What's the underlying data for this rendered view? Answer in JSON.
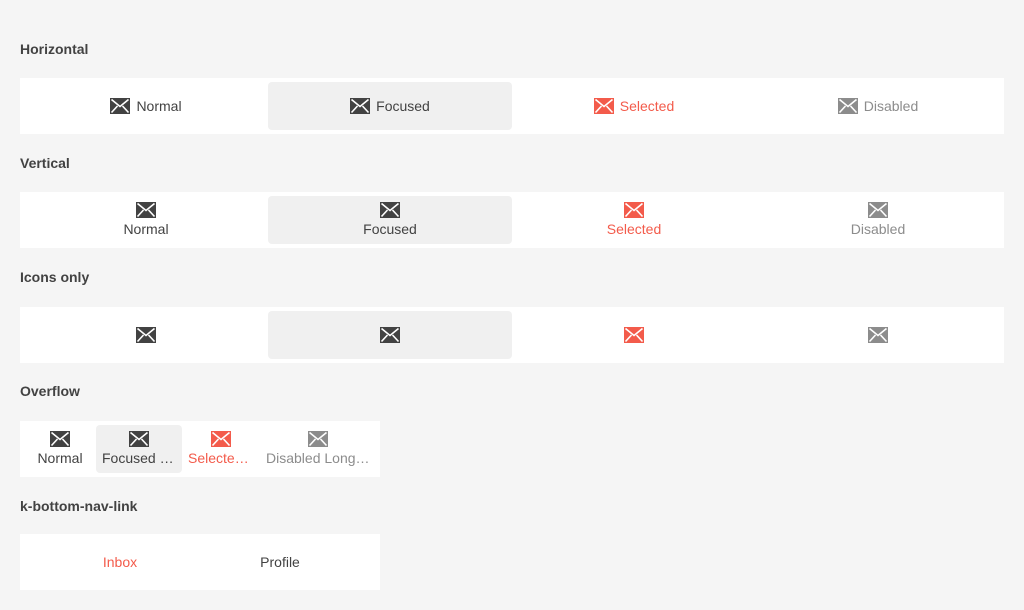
{
  "icons": {
    "mail": "envelope-icon"
  },
  "colors": {
    "selected": "#f35b4b",
    "normal": "#424242",
    "disabled": "#8c8c8c",
    "focused_bg": "#f0f0f0"
  },
  "sections": {
    "horizontal": {
      "title": "Horizontal",
      "items": [
        "Normal",
        "Focused",
        "Selected",
        "Disabled"
      ]
    },
    "vertical": {
      "title": "Vertical",
      "items": [
        "Normal",
        "Focused",
        "Selected",
        "Disabled"
      ]
    },
    "icons_only": {
      "title": "Icons only"
    },
    "overflow": {
      "title": "Overflow",
      "items": [
        "Normal",
        "Focused Long Text",
        "Selected Long Text",
        "Disabled Long Text"
      ]
    },
    "links": {
      "title": "k-bottom-nav-link",
      "items": [
        "Inbox",
        "Profile"
      ]
    }
  }
}
